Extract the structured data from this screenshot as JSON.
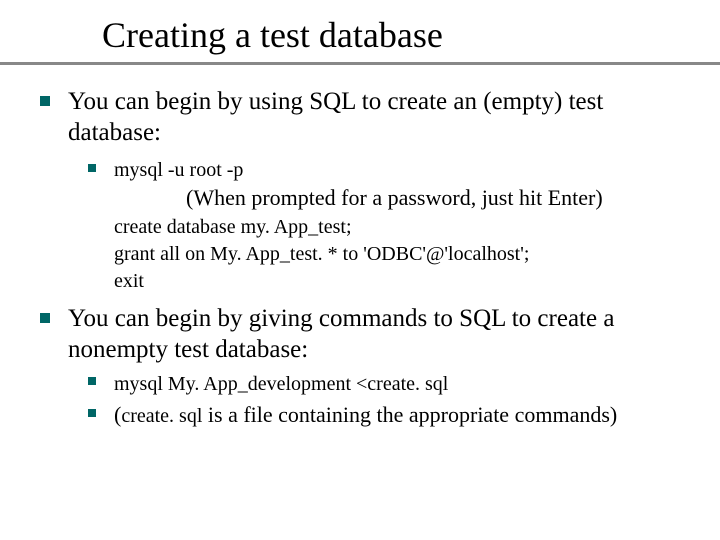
{
  "title": "Creating a test database",
  "items": [
    {
      "text": "You can begin by using SQL to create an (empty) test database:",
      "sub": {
        "cmd": "mysql -u root -p",
        "note": "(When prompted for a password, just hit Enter)",
        "code": [
          "create database my. App_test;",
          "grant all on My. App_test. * to 'ODBC'@'localhost';",
          "exit"
        ]
      }
    },
    {
      "text": "You can begin by giving commands to SQL to create a nonempty test database:",
      "subs": [
        {
          "code": "mysql My. App_development <create. sql"
        },
        {
          "prefix": "(",
          "code": "create. sql",
          "suffix": " is a file containing the appropriate commands)"
        }
      ]
    }
  ]
}
